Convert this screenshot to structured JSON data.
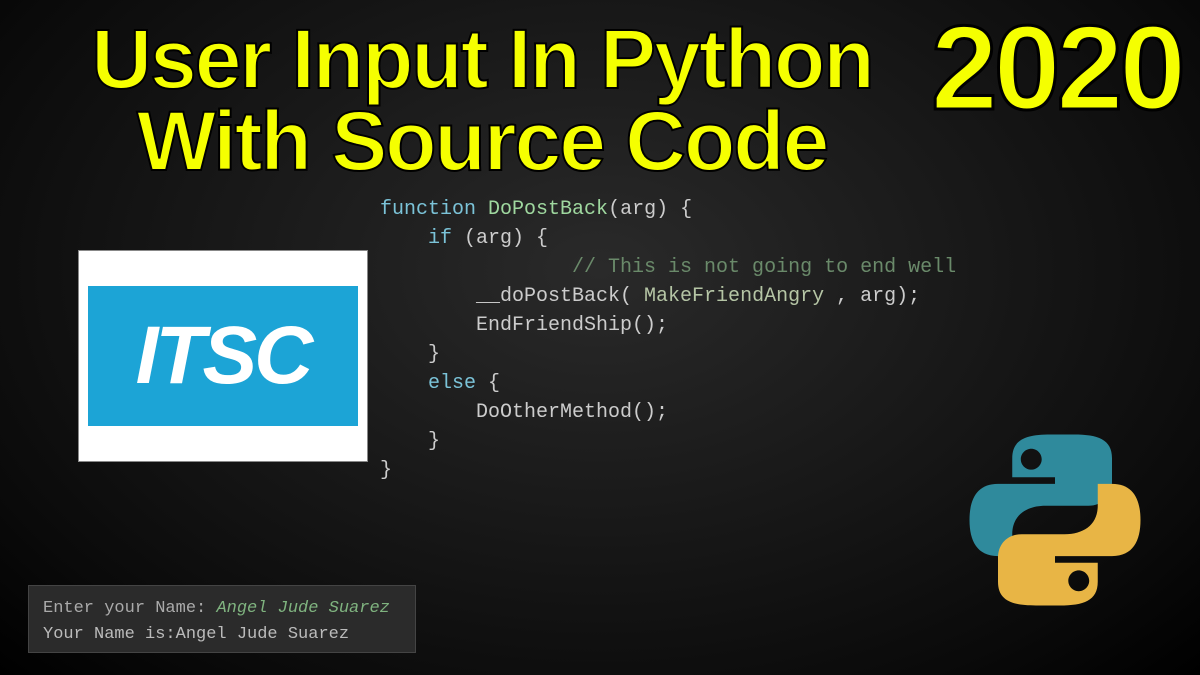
{
  "title": {
    "line1": "User Input In Python",
    "line2": "With Source Code"
  },
  "year": "2020",
  "logo": {
    "text": "ITSC"
  },
  "code": {
    "line0": "function DoPostBack(arg) {",
    "line1": "    if (arg) {",
    "line2": "        // This is not going to end well",
    "line3a": "        __doPostBack( ",
    "line3b": "MakeFriendAngry",
    "line3c": " , arg);",
    "line4": "        EndFriendShip();",
    "line5": "    }",
    "line6": "    else {",
    "line7": "        DoOtherMethod();",
    "line8": "    }",
    "line9": "}"
  },
  "terminal": {
    "prompt": "Enter your Name: ",
    "input": "Angel Jude Suarez",
    "output": "Your Name is:Angel Jude Suarez"
  }
}
